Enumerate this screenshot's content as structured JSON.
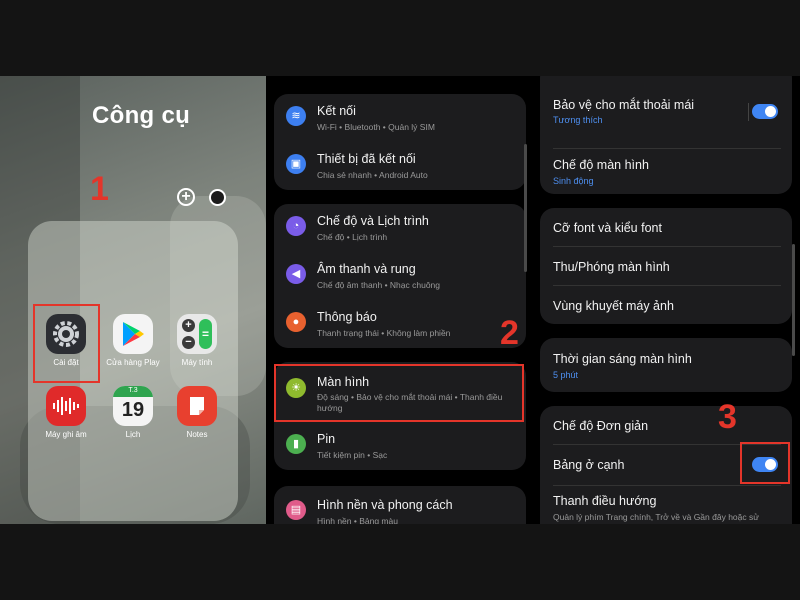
{
  "folder": {
    "title": "Công cụ",
    "step": "1",
    "add_icon": "plus-circle-icon",
    "apps": [
      {
        "label": "Cài đặt",
        "icon": "gear-icon"
      },
      {
        "label": "Cửa hàng Play",
        "icon": "play-store-icon"
      },
      {
        "label": "Máy tính",
        "icon": "calculator-icon"
      },
      {
        "label": "Máy ghi âm",
        "icon": "voice-recorder-icon"
      },
      {
        "label": "Lịch",
        "icon": "calendar-icon",
        "day": "T.3",
        "date": "19"
      },
      {
        "label": "Notes",
        "icon": "notes-icon"
      }
    ]
  },
  "settings": {
    "step": "2",
    "items": [
      {
        "title": "Kết nối",
        "subtitle": "Wi-Fi • Bluetooth • Quản lý SIM",
        "icon": "wifi-icon",
        "color": "#3d7ff0"
      },
      {
        "title": "Thiết bị đã kết nối",
        "subtitle": "Chia sẻ nhanh • Android Auto",
        "icon": "devices-icon",
        "color": "#3d7ff0"
      },
      {
        "title": "Chế độ và Lịch trình",
        "subtitle": "Chế độ • Lịch trình",
        "icon": "modes-icon",
        "color": "#7a5ce8"
      },
      {
        "title": "Âm thanh và rung",
        "subtitle": "Chế độ âm thanh • Nhạc chuông",
        "icon": "sound-icon",
        "color": "#7a5ce8"
      },
      {
        "title": "Thông báo",
        "subtitle": "Thanh trạng thái • Không làm phiền",
        "icon": "bell-icon",
        "color": "#e8612f"
      },
      {
        "title": "Màn hình",
        "subtitle": "Độ sáng • Bảo vệ cho mắt thoải mái • Thanh điều hướng",
        "icon": "brightness-icon",
        "color": "#8fba2e"
      },
      {
        "title": "Pin",
        "subtitle": "Tiết kiệm pin • Sạc",
        "icon": "battery-icon",
        "color": "#4caf50"
      },
      {
        "title": "Hình nền và phong cách",
        "subtitle": "Hình nền • Bảng màu",
        "icon": "wallpaper-icon",
        "color": "#e05b8a"
      }
    ]
  },
  "display": {
    "step": "3",
    "eye_comfort": {
      "title": "Bảo vệ cho mắt thoải mái",
      "subtitle": "Tương thích",
      "on": true
    },
    "screen_mode": {
      "title": "Chế độ màn hình",
      "subtitle": "Sinh động"
    },
    "font": {
      "title": "Cỡ font và kiểu font"
    },
    "zoom": {
      "title": "Thu/Phóng màn hình"
    },
    "camera_cutout": {
      "title": "Vùng khuyết máy ảnh"
    },
    "timeout": {
      "title": "Thời gian sáng màn hình",
      "subtitle": "5 phút"
    },
    "easy_mode": {
      "title": "Chế độ Đơn giản"
    },
    "edge_panels": {
      "title": "Bảng ở cạnh",
      "on": true
    },
    "nav_bar": {
      "title": "Thanh điều hướng",
      "desc": "Quản lý phím Trang chính, Trở về và Gần đây hoặc sử"
    }
  }
}
